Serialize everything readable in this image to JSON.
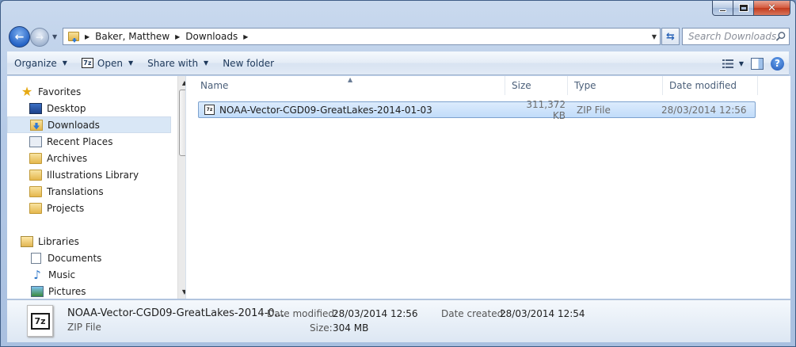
{
  "address": {
    "crumbs": [
      "Baker, Matthew",
      "Downloads"
    ],
    "search_placeholder": "Search Downloads"
  },
  "toolbar": {
    "organize": "Organize",
    "open": "Open",
    "share_with": "Share with",
    "new_folder": "New folder"
  },
  "navpane": {
    "favorites": "Favorites",
    "favorites_items": [
      "Desktop",
      "Downloads",
      "Recent Places",
      "Archives",
      "Illustrations Library",
      "Translations",
      "Projects"
    ],
    "libraries": "Libraries",
    "libraries_items": [
      "Documents",
      "Music",
      "Pictures"
    ],
    "selected": "Downloads"
  },
  "columns": {
    "name": "Name",
    "size": "Size",
    "type": "Type",
    "date_modified": "Date modified"
  },
  "files": [
    {
      "name": "NOAA-Vector-CGD09-GreatLakes-2014-01-03",
      "size": "311,372 KB",
      "type": "ZIP File",
      "date_modified": "28/03/2014 12:56"
    }
  ],
  "details": {
    "name": "NOAA-Vector-CGD09-GreatLakes-2014-0...",
    "type": "ZIP File",
    "date_modified_label": "Date modified:",
    "date_modified_value": "28/03/2014 12:56",
    "date_created_label": "Date created:",
    "date_created_value": "28/03/2014 12:54",
    "size_label": "Size:",
    "size_value": "304 MB"
  },
  "icons": {
    "archive_badge": "7z"
  }
}
